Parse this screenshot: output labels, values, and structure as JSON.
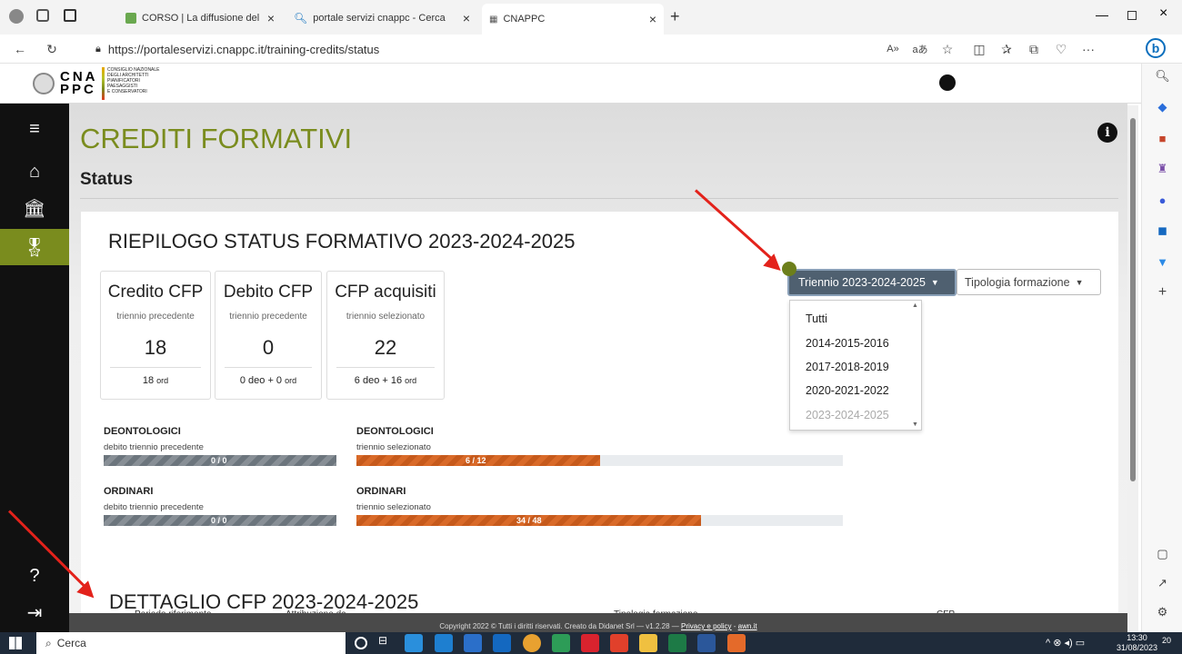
{
  "browser": {
    "tabs": [
      {
        "label": "CORSO | La diffusione della cultu",
        "active": false
      },
      {
        "label": "portale servizi cnappc - Cerca",
        "active": false
      },
      {
        "label": "CNAPPC",
        "active": true
      }
    ],
    "url": "https://portaleservizi.cnappc.it/training-credits/status"
  },
  "header": {
    "logo_letters": "CNA PPC",
    "logo_lines": [
      "CONSIGLIO NAZIONALE",
      "DEGLI ARCHITETTI",
      "PIANIFICATORI",
      "PAESAGGISTI",
      "E CONSERVATORI"
    ]
  },
  "page": {
    "title": "CREDITI FORMATIVI",
    "subtitle": "Status"
  },
  "summary": {
    "title": "RIEPILOGO STATUS FORMATIVO 2023-2024-2025",
    "cards": [
      {
        "title": "Credito CFP",
        "sub": "triennio precedente",
        "value": "18",
        "foot_num": "18",
        "foot_label": "ord"
      },
      {
        "title": "Debito CFP",
        "sub": "triennio precedente",
        "value": "0",
        "foot_num": "0 deo + 0",
        "foot_label": "ord"
      },
      {
        "title": "CFP acquisiti",
        "sub": "triennio selezionato",
        "value": "22",
        "foot_num": "6 deo + 16",
        "foot_label": "ord"
      }
    ],
    "progress": [
      {
        "label": "DEONTOLOGICI",
        "sub": "debito triennio precedente",
        "text": "0 / 0",
        "fraction": 0,
        "style": "grey"
      },
      {
        "label": "DEONTOLOGICI",
        "sub": "triennio selezionato",
        "text": "6 / 12",
        "fraction": 0.5,
        "style": "orange"
      },
      {
        "label": "ORDINARI",
        "sub": "debito triennio precedente",
        "text": "0 / 0",
        "fraction": 0,
        "style": "grey"
      },
      {
        "label": "ORDINARI",
        "sub": "triennio selezionato",
        "text": "34 / 48",
        "fraction": 0.708,
        "style": "orange"
      }
    ]
  },
  "filters": {
    "triennio_label": "Triennio 2023-2024-2025",
    "tipologia_label": "Tipologia formazione",
    "options": [
      "Tutti",
      "2014-2015-2016",
      "2017-2018-2019",
      "2020-2021-2022",
      "2023-2024-2025"
    ]
  },
  "detail": {
    "title": "DETTAGLIO CFP 2023-2024-2025",
    "columns": [
      "Periodo riferimento",
      "Attribuzione da",
      "Tipologia formazione",
      "CFP"
    ]
  },
  "footer": {
    "text": "Copyright 2022 © Tutti i diritti riservati. Creato da Didanet Srl — v1.2.28 —",
    "link1": "Privacy e policy",
    "link2": "awn.it"
  },
  "taskbar": {
    "search": "Cerca",
    "time": "13:30",
    "date": "31/08/2023",
    "notif": "20"
  },
  "colors": {
    "title_green": "#7a8c1e",
    "sidebar_active": "#7a8c1e",
    "dropdown_bg": "#4f6070",
    "bar_orange": "#d3651f"
  }
}
